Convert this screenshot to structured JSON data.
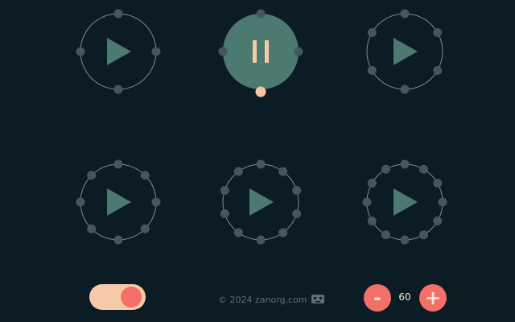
{
  "colors": {
    "background": "#0b1c24",
    "ring": "#7a8e93",
    "dot": "#46565e",
    "play": "#4c7a70",
    "active_fill": "#4c7a70",
    "pause": "#f6c9a8",
    "accent_dot": "#f7c4a0",
    "toggle_track": "#f6c9a8",
    "toggle_knob": "#f27065",
    "round_button": "#f27065",
    "round_button_text": "#f6e4d6",
    "footer_text": "#5b6f78"
  },
  "pads": [
    {
      "name": "pad-1",
      "beats": 4,
      "state": "play",
      "icon": "play-icon"
    },
    {
      "name": "pad-2",
      "beats": 4,
      "state": "pause",
      "icon": "pause-icon",
      "active_beat": 2
    },
    {
      "name": "pad-3",
      "beats": 6,
      "state": "play",
      "icon": "play-icon"
    },
    {
      "name": "pad-4",
      "beats": 8,
      "state": "play",
      "icon": "play-icon"
    },
    {
      "name": "pad-5",
      "beats": 10,
      "state": "play",
      "icon": "play-icon"
    },
    {
      "name": "pad-6",
      "beats": 12,
      "state": "play",
      "icon": "play-icon"
    }
  ],
  "footer": {
    "toggle_on": true,
    "credit_text": "© 2024 zanorg.com",
    "credit_icon": "robot-icon",
    "minus_label": "-",
    "plus_label": "+",
    "tempo": "60"
  }
}
